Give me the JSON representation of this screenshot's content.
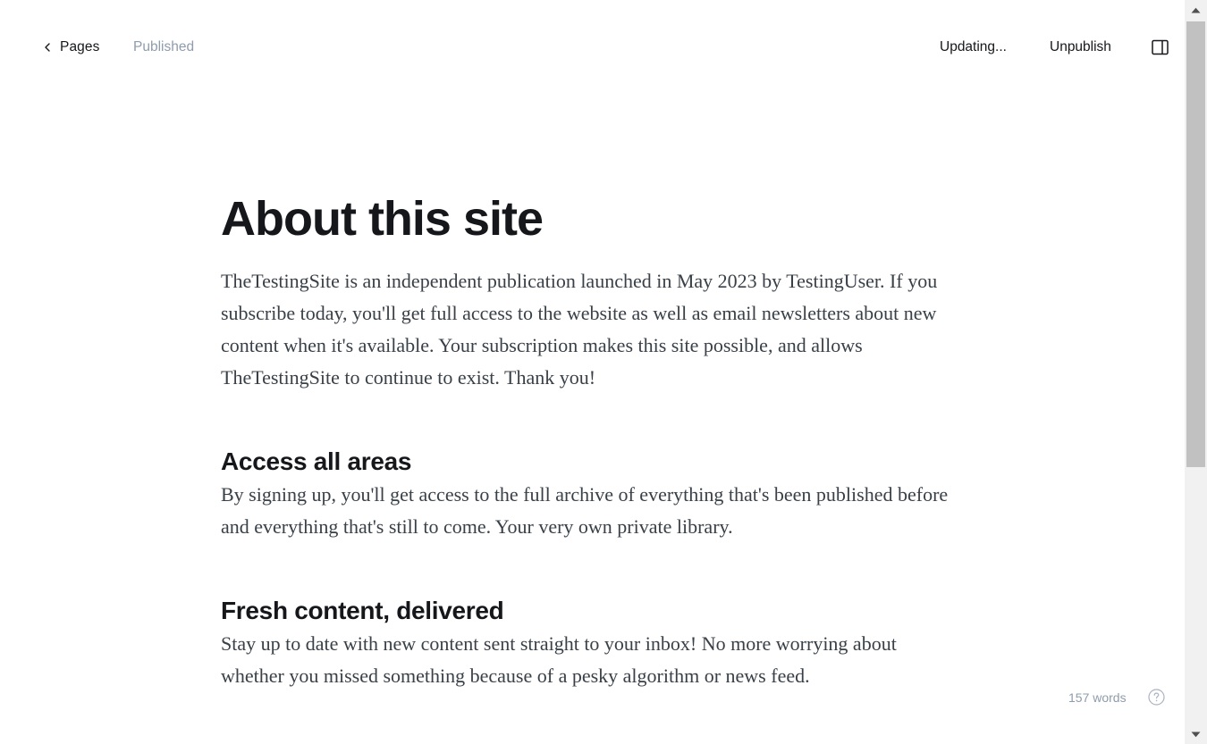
{
  "header": {
    "back_label": "Pages",
    "status": "Published",
    "updating": "Updating...",
    "unpublish_label": "Unpublish"
  },
  "post": {
    "title": "About this site",
    "intro": "TheTestingSite is an independent publication launched in May 2023 by TestingUser. If you subscribe today, you'll get full access to the website as well as email newsletters about new content when it's available. Your subscription makes this site possible, and allows TheTestingSite to continue to exist. Thank you!",
    "sections": [
      {
        "heading": "Access all areas",
        "text": "By signing up, you'll get access to the full archive of everything that's been published before and everything that's still to come. Your very own private library."
      },
      {
        "heading": "Fresh content, delivered",
        "text": "Stay up to date with new content sent straight to your inbox! No more worrying about whether you missed something because of a pesky algorithm or news feed."
      }
    ]
  },
  "footer": {
    "word_count": "157 words"
  },
  "icons": {
    "back": "chevron-left-icon",
    "sidebar": "sidebar-toggle-icon",
    "help": "question-circle-icon"
  },
  "colors": {
    "text": "#15171a",
    "muted": "#8e9cac",
    "body": "#394047"
  }
}
